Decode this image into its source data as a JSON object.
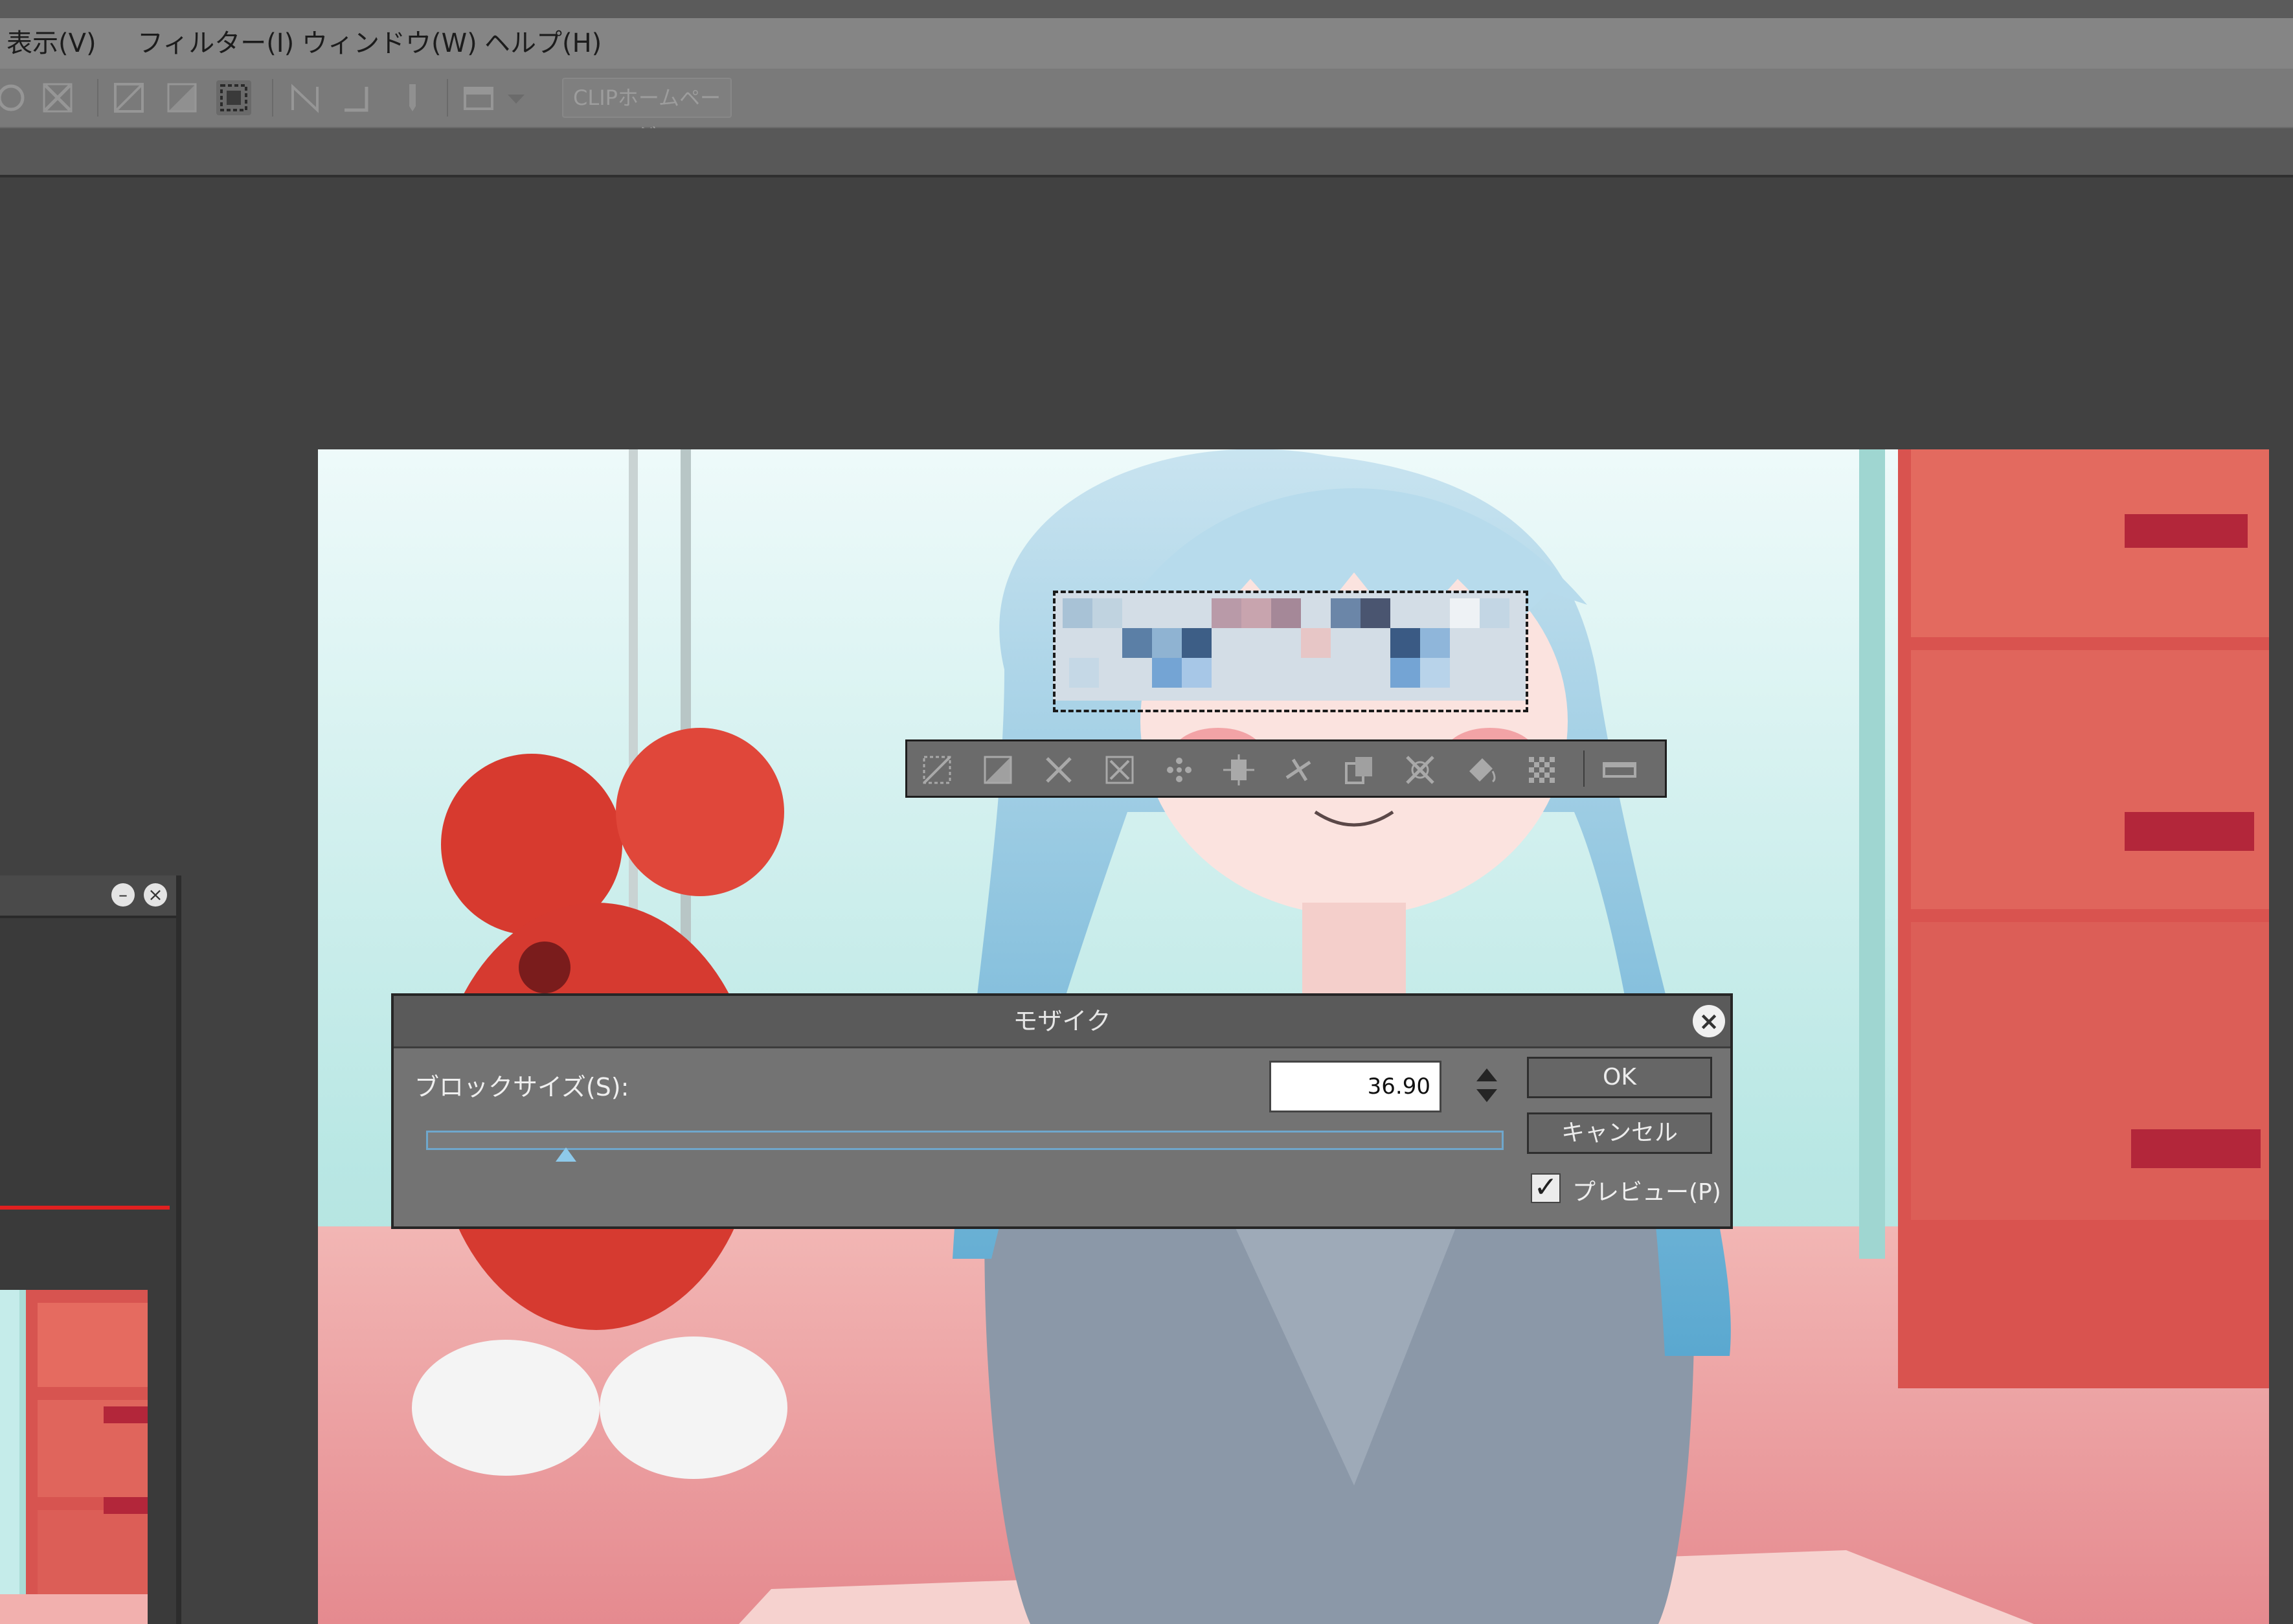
{
  "menu": {
    "items": [
      {
        "label": "表示(V)"
      },
      {
        "label": "フィルター(I)"
      },
      {
        "label": "ウィンドウ(W)"
      },
      {
        "label": "ヘルプ(H)"
      }
    ]
  },
  "commandbar": {
    "clip_button": "CLIPホームページ"
  },
  "dialog": {
    "title": "モザイク",
    "block_size_label": "ブロックサイズ(S):",
    "block_size_value": "36.90",
    "slider_fraction": 0.13,
    "ok_label": "OK",
    "cancel_label": "キャンセル",
    "preview_label": "プレビュー(P)",
    "preview_checked": true
  },
  "colors": {
    "accent": "#6fa7cc",
    "navigator_line": "#e02020"
  }
}
